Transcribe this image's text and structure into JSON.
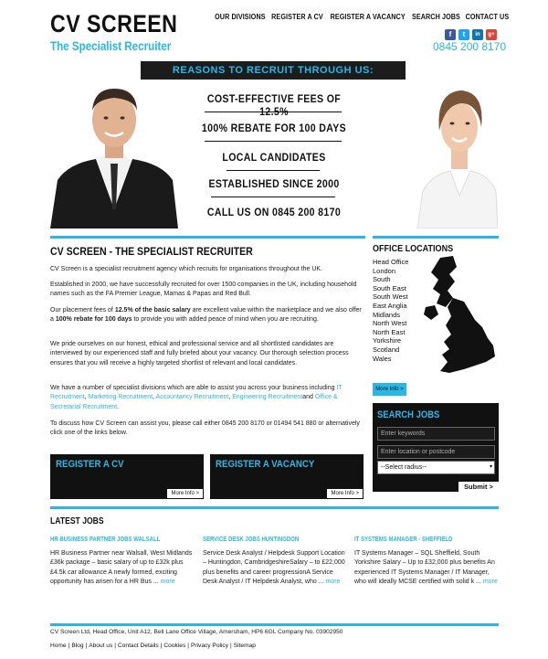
{
  "header": {
    "logo_main": "CV SCREEN",
    "logo_sub": "The Specialist Recruiter",
    "phone": "0845 200 8170",
    "nav": [
      "OUR DIVISIONS",
      "REGISTER A CV",
      "REGISTER A VACANCY",
      "SEARCH JOBS",
      "CONTACT US"
    ],
    "social": [
      {
        "icon": "facebook-icon",
        "glyph": "f",
        "color": "#3b5998"
      },
      {
        "icon": "twitter-icon",
        "glyph": "t",
        "color": "#1da1f2"
      },
      {
        "icon": "linkedin-icon",
        "glyph": "in",
        "color": "#0e76a8"
      },
      {
        "icon": "googleplus-icon",
        "glyph": "g+",
        "color": "#d34836"
      }
    ]
  },
  "hero": {
    "banner": "REASONS TO RECRUIT THROUGH US:",
    "reasons": [
      "COST-EFFECTIVE FEES OF 12.5%",
      "100% REBATE FOR 100 DAYS",
      "LOCAL CANDIDATES",
      "ESTABLISHED SINCE 2000",
      "CALL US ON 0845 200 8170"
    ]
  },
  "main": {
    "title": "CV SCREEN - THE SPECIALIST RECRUITER",
    "p1": "CV Screen is a specialist recruitment agency which recruits for organisations throughout the UK.",
    "p2": "Established in 2000, we have successfully recruited for over 1500 companies in the UK, including household names such as the FA Premier League, Mamas & Papas and Red Bull.",
    "p3_a": "Our placement fees of ",
    "p3_b": "12.5% of the basic salary",
    "p3_c": " are excellent value within the marketplace and we also offer a ",
    "p3_d": "100% rebate for 100 days",
    "p3_e": " to provide you with added peace of mind when you are recruiting.",
    "p4": "We pride ourselves on our honest, ethical and professional service and all shortlisted candidates are interviewed by our experienced staff and fully briefed about your vacancy. Our thorough selection process ensures that you will receive a highly targeted shortlist of relevant and local candidates.",
    "p5_a": "We have a number of specialist divisions which are able to assist you across your business including ",
    "p5_links": [
      "IT Recruitment",
      "Marketing Recruitment",
      "Accountancy Recruitment",
      "Engineering Recruitment"
    ],
    "p5_and": "and ",
    "p5_last": "Office & Secretarial Recruitment",
    "p5_end": ".",
    "p6": "To discuss how CV Screen can assist you, please call either 0845 200 8170 or 01494 541 880 or alternatively click one of the links below.",
    "register_cv": "REGISTER A CV",
    "register_vacancy": "REGISTER A VACANCY",
    "more_info": "More Info >"
  },
  "sidebar": {
    "office_title": "OFFICE LOCATIONS",
    "offices": [
      "Head Office",
      "London",
      "South",
      "South East",
      "South West",
      "East Anglia",
      "Midlands",
      "North West",
      "North East",
      "Yorkshire",
      "Scotland",
      "Wales"
    ],
    "more_info": "More Info >",
    "search_title": "SEARCH JOBS",
    "keywords_placeholder": "Enter keywords",
    "location_placeholder": "Enter location or postcode",
    "radius": "--Select radius--",
    "submit": "Submit >"
  },
  "jobs": {
    "title": "LATEST JOBS",
    "items": [
      {
        "title": "HR BUSINESS PARTNER JOBS WALSALL",
        "desc": "HR Business Partner near Walsall, West Midlands £36k package – basic salary of up to £32k plus £4.5k car allowance A newly formed, exciting opportunity has arisen for a HR Bus ...",
        "more": "more"
      },
      {
        "title": "SERVICE DESK JOBS HUNTINGDON",
        "desc": "Service Desk Analyst / Helpdesk Support Location – Huntingdon, CambridgeshireSalary – to £22,000 plus benefits and career progressionA Service Desk Analyst / IT Helpdesk Analyst, who ...",
        "more": "more"
      },
      {
        "title": "IT SYSTEMS MANAGER - SHEFFIELD",
        "desc": "IT Systems Manager – SQL Sheffield, South Yorkshire Salary – Up to £32,000 plus benefits An experienced IT Systems Manager / IT Manager, who will ideally MCSE certified with solid k ...",
        "more": "more"
      }
    ]
  },
  "footer": {
    "address": "CV Screen Ltd, Head Office, Unit A12, Bell Lane Office Village, Amersham, HP6 6GL Company No. 03902950",
    "links": [
      "Home",
      "Blog",
      "About us",
      "Contact Details",
      "Cookies",
      "Privacy Policy",
      "Sitemap"
    ]
  },
  "colors": {
    "accent": "#29b7e6",
    "dark": "#111111"
  }
}
